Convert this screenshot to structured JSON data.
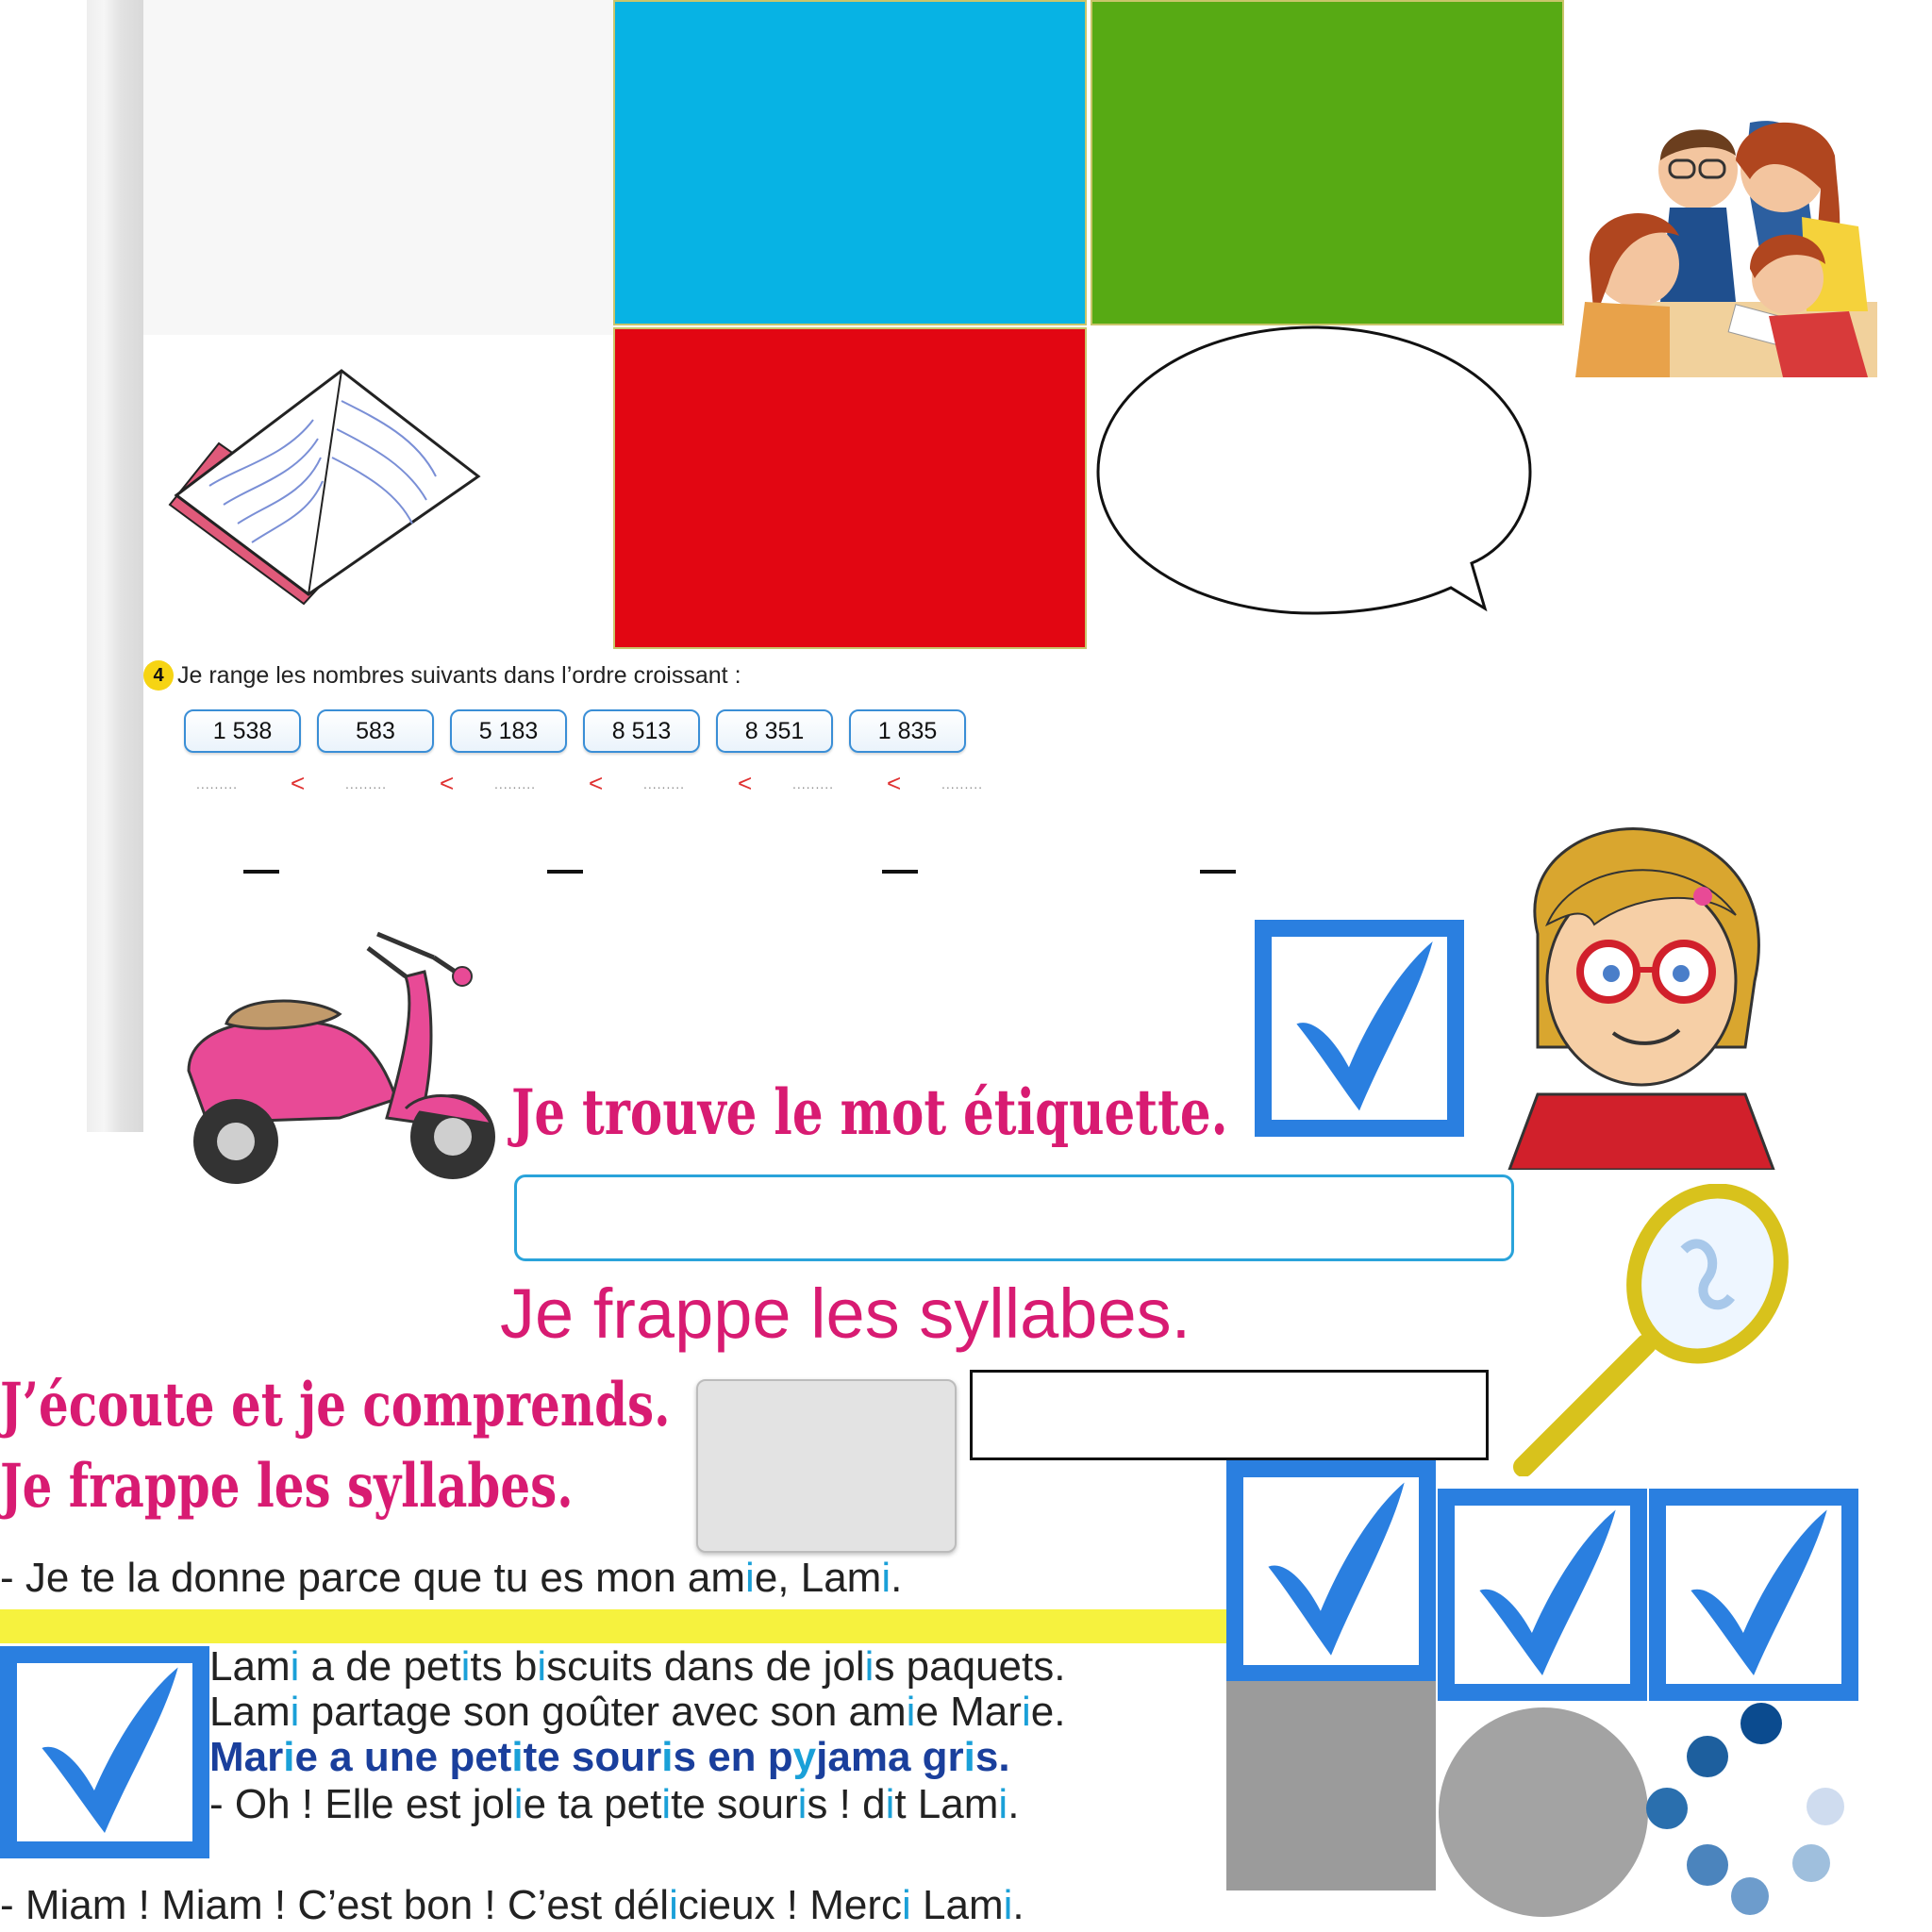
{
  "exercise": {
    "number": "4",
    "instruction": "Je range les nombres suivants dans l’ordre croissant :",
    "numbers": [
      "1 538",
      "583",
      "5 183",
      "8 513",
      "8 351",
      "1 835"
    ],
    "placeholder": ".........",
    "comparator": "<"
  },
  "headings": {
    "mot_etiquette": "Je trouve le mot étiquette.",
    "frappe_syllabes": "Je frappe les syllabes.",
    "ecoute": "J’écoute et je comprends.",
    "frappe_syllabes_2": "Je frappe les syllabes."
  },
  "story": {
    "line_before": [
      "- Je te la donne parce que tu es mon am",
      "i",
      "e, Lam",
      "i",
      "."
    ],
    "line1": [
      "Lam",
      "i",
      " a de pet",
      "i",
      "ts b",
      "i",
      "scuits dans de jol",
      "i",
      "s paquets."
    ],
    "line2": [
      "Lam",
      "i",
      " partage son goûter avec son am",
      "i",
      "e Mar",
      "i",
      "e."
    ],
    "line3": [
      "Mar",
      "i",
      "e a une pet",
      "i",
      "te sour",
      "i",
      "s en p",
      "y",
      "jama gr",
      "i",
      "s."
    ],
    "line4": [
      "- Oh ! Elle est jol",
      "i",
      "e ta pet",
      "i",
      "te sour",
      "i",
      "s ! d",
      "i",
      "t Lam",
      "i",
      "."
    ],
    "line_last": [
      "- Miam ! Miam ! C’est bon ! C’est  dél",
      "i",
      "cieux ! Merc",
      "i",
      " Lam",
      "i",
      "."
    ]
  },
  "colors": {
    "tile_blue": "#07b3e4",
    "tile_green": "#57aa14",
    "tile_red": "#e20612",
    "heading_pink": "#d81b72",
    "highlight_i": "#1aa0d8",
    "check_blue": "#2a7fe0",
    "yellow_bar": "#f6f23e"
  },
  "icons": [
    "book-icon",
    "kids-group-illustration",
    "speech-bubble-icon",
    "scooter-illustration",
    "girl-glasses-illustration",
    "mirror-icon",
    "checkbox-checked-icon",
    "loading-dots-icon"
  ]
}
